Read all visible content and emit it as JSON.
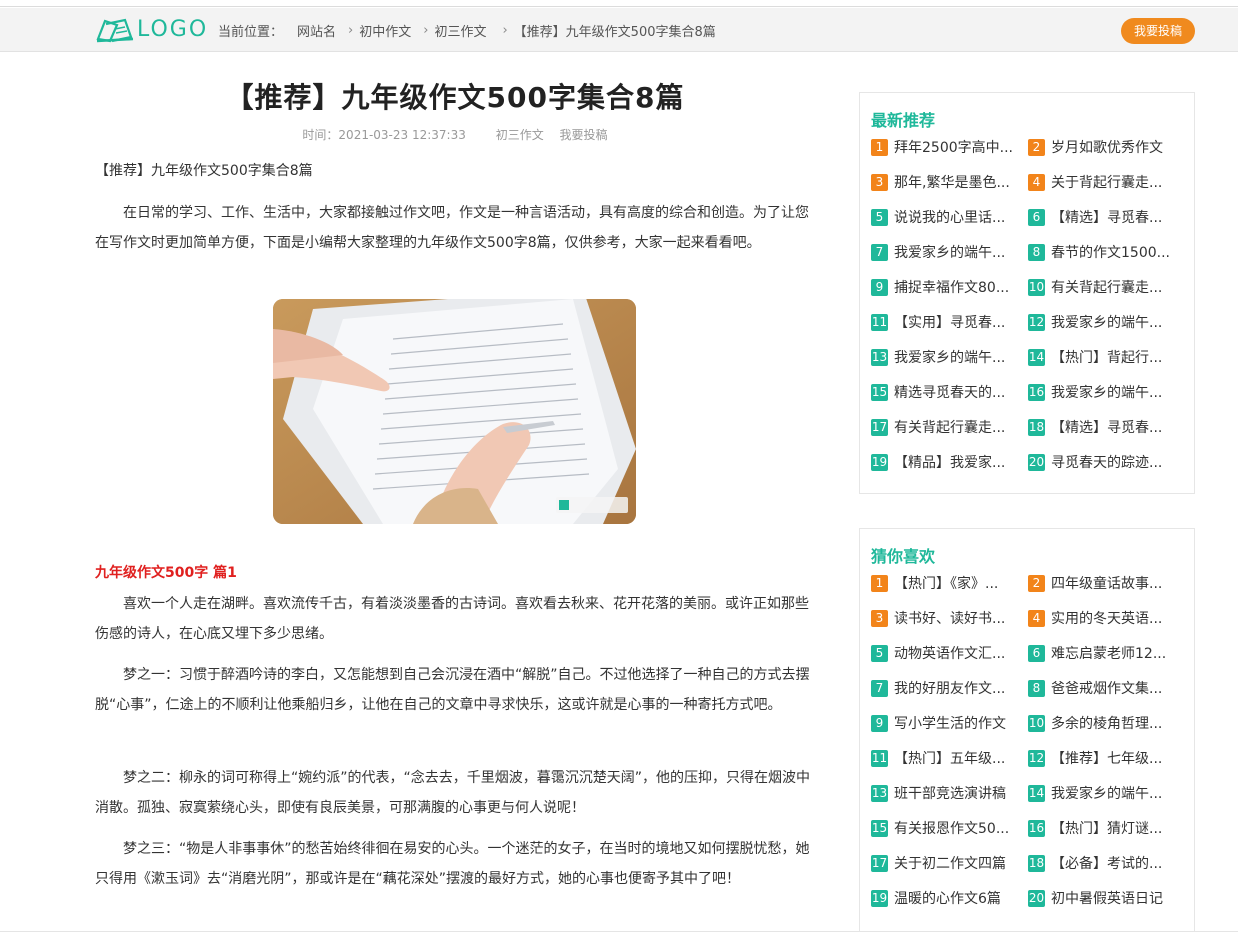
{
  "header": {
    "logo_text": "LOGO",
    "breadcrumb_label": "当前位置：",
    "breadcrumbs": [
      "网站名",
      "初中作文",
      "初三作文",
      "【推荐】九年级作文500字集合8篇"
    ],
    "submit_label": "我要投稿",
    "accent": "#1fb89a",
    "button_color": "#f08a1e"
  },
  "article": {
    "title": "【推荐】九年级作文500字集合8篇",
    "meta_time": "时间：2021-03-23 12:37:33",
    "meta_category": "初三作文",
    "meta_submit": "我要投稿",
    "subtitle": "【推荐】九年级作文500字集合8篇",
    "intro": "在日常的学习、工作、生活中，大家都接触过作文吧，作文是一种言语活动，具有高度的综合和创造。为了让您在写作文时更加简单方便，下面是小编帮大家整理的九年级作文500字8篇，仅供参考，大家一起来看看吧。",
    "section_title": "九年级作文500字 篇1",
    "paragraphs": [
      "喜欢一个人走在湖畔。喜欢流传千古，有着淡淡墨香的古诗词。喜欢看去秋来、花开花落的美丽。或许正如那些伤感的诗人，在心底又埋下多少思绪。",
      "梦之一：习惯于醉酒吟诗的李白，又怎能想到自己会沉浸在酒中“解脱”自己。不过他选择了一种自己的方式去摆脱“心事”，仁途上的不顺利让他乘船归乡，让他在自己的文章中寻求快乐，这或许就是心事的一种寄托方式吧。",
      "梦之二：柳永的词可称得上“婉约派”的代表，“念去去，千里烟波，暮霭沉沉楚天阔”，他的压抑，只得在烟波中消散。孤独、寂寞萦绕心头，即使有良辰美景，可那满腹的心事更与何人说呢！",
      "梦之三：“物是人非事事休”的愁苦始终徘徊在易安的心头。一个迷茫的女子，在当时的境地又如何摆脱忧愁，她只得用《漱玉词》去“消磨光阴”，那或许是在“藕花深处”摆渡的最好方式，她的心事也便寄予其中了吧！"
    ]
  },
  "sidebar": {
    "latest_title": "最新推荐",
    "latest": [
      "拜年2500字高中...",
      "岁月如歌优秀作文",
      "那年,繁华是墨色...",
      "关于背起行囊走...",
      "说说我的心里话...",
      "【精选】寻觅春...",
      "我爱家乡的端午...",
      "春节的作文1500...",
      "捕捉幸福作文80...",
      "有关背起行囊走...",
      "【实用】寻觅春...",
      "我爱家乡的端午...",
      "我爱家乡的端午...",
      "【热门】背起行...",
      "精选寻觅春天的...",
      "我爱家乡的端午...",
      "有关背起行囊走...",
      "【精选】寻觅春...",
      "【精品】我爱家...",
      "寻觅春天的踪迹..."
    ],
    "guess_title": "猜你喜欢",
    "guess": [
      "【热门】《家》...",
      "四年级童话故事...",
      "读书好、读好书...",
      "实用的冬天英语...",
      "动物英语作文汇...",
      "难忘启蒙老师12...",
      "我的好朋友作文...",
      "爸爸戒烟作文集...",
      "写小学生活的作文",
      "多余的棱角哲理...",
      "【热门】五年级...",
      "【推荐】七年级...",
      "班干部竞选演讲稿",
      "我爱家乡的端午...",
      "有关报恩作文50...",
      "【热门】猜灯谜...",
      "关于初二作文四篇",
      "【必备】考试的...",
      "温暖的心作文6篇",
      "初中暑假英语日记"
    ]
  }
}
